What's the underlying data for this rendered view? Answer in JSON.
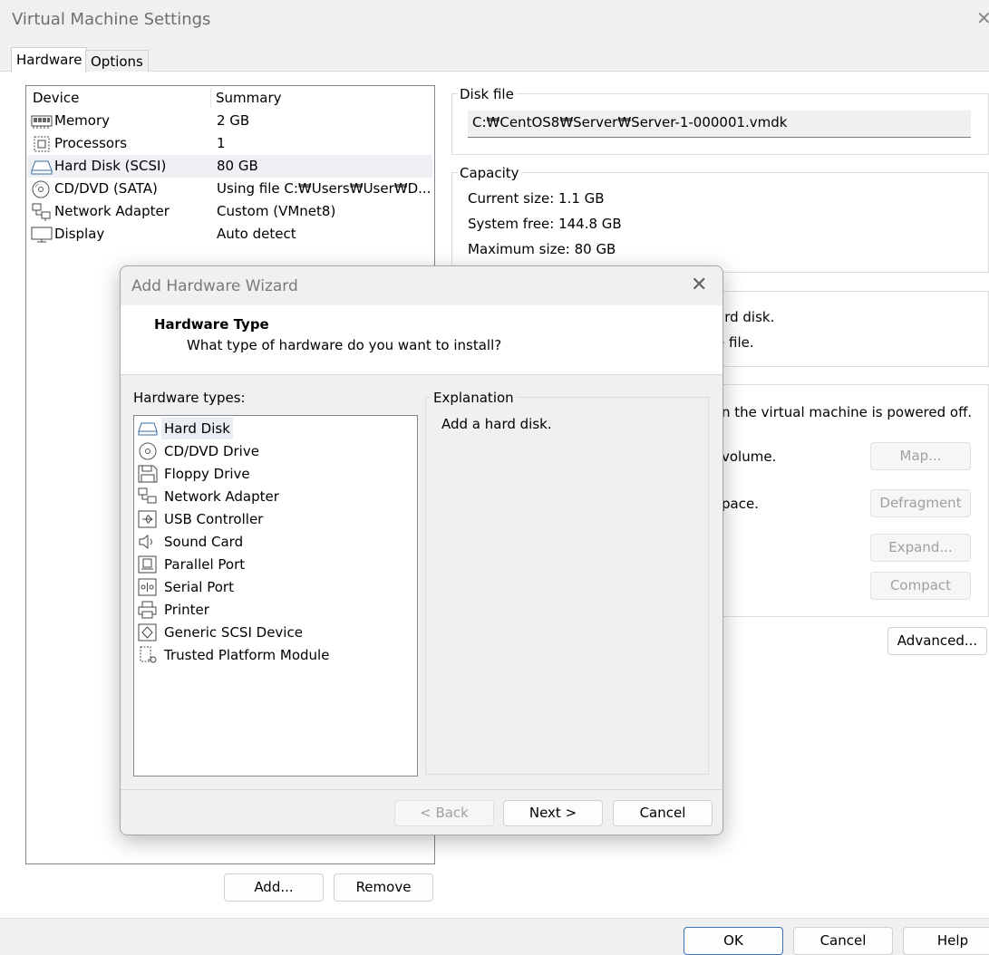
{
  "window": {
    "title": "Virtual Machine Settings"
  },
  "tabs": [
    {
      "label": "Hardware"
    },
    {
      "label": "Options"
    }
  ],
  "device_list": {
    "headers": {
      "device": "Device",
      "summary": "Summary"
    },
    "items": [
      {
        "name": "Memory",
        "summary": "2 GB",
        "icon": "memory-icon"
      },
      {
        "name": "Processors",
        "summary": "1",
        "icon": "processor-icon"
      },
      {
        "name": "Hard Disk (SCSI)",
        "summary": "80 GB",
        "icon": "hard-disk-icon"
      },
      {
        "name": "CD/DVD (SATA)",
        "summary": "Using file C:₩Users₩User₩D...",
        "icon": "cd-dvd-icon"
      },
      {
        "name": "Network Adapter",
        "summary": "Custom (VMnet8)",
        "icon": "network-adapter-icon"
      },
      {
        "name": "Display",
        "summary": "Auto detect",
        "icon": "display-icon"
      }
    ]
  },
  "device_buttons": {
    "add": "Add...",
    "remove": "Remove"
  },
  "disk_file": {
    "label": "Disk file",
    "path": "C:₩CentOS8₩Server₩Server-1-000001.vmdk"
  },
  "capacity": {
    "label": "Capacity",
    "current": "Current size: 1.1 GB",
    "system_free": "System free: 144.8 GB",
    "maximum": "Maximum size: 80 GB"
  },
  "disk_info": {
    "line1": "ard disk.",
    "line2": "e file."
  },
  "utilities": {
    "note": "n the virtual machine is powered off.",
    "map_desc": "volume.",
    "defrag_desc": "pace.",
    "map": "Map...",
    "defragment": "Defragment",
    "expand": "Expand...",
    "compact": "Compact"
  },
  "advanced": "Advanced...",
  "footer": {
    "ok": "OK",
    "cancel": "Cancel",
    "help": "Help"
  },
  "wizard": {
    "title": "Add Hardware Wizard",
    "heading": "Hardware Type",
    "subheading": "What type of hardware do you want to install?",
    "types_label": "Hardware types:",
    "types": [
      {
        "name": "Hard Disk",
        "icon": "hard-disk-icon"
      },
      {
        "name": "CD/DVD Drive",
        "icon": "cd-dvd-icon"
      },
      {
        "name": "Floppy Drive",
        "icon": "floppy-icon"
      },
      {
        "name": "Network Adapter",
        "icon": "network-adapter-icon"
      },
      {
        "name": "USB Controller",
        "icon": "usb-icon"
      },
      {
        "name": "Sound Card",
        "icon": "speaker-icon"
      },
      {
        "name": "Parallel Port",
        "icon": "parallel-port-icon"
      },
      {
        "name": "Serial Port",
        "icon": "serial-port-icon"
      },
      {
        "name": "Printer",
        "icon": "printer-icon"
      },
      {
        "name": "Generic SCSI Device",
        "icon": "scsi-device-icon"
      },
      {
        "name": "Trusted Platform Module",
        "icon": "tpm-icon"
      }
    ],
    "selected_type": "Hard Disk",
    "explanation_label": "Explanation",
    "explanation": "Add a hard disk.",
    "back": "< Back",
    "next": "Next >",
    "cancel": "Cancel"
  }
}
